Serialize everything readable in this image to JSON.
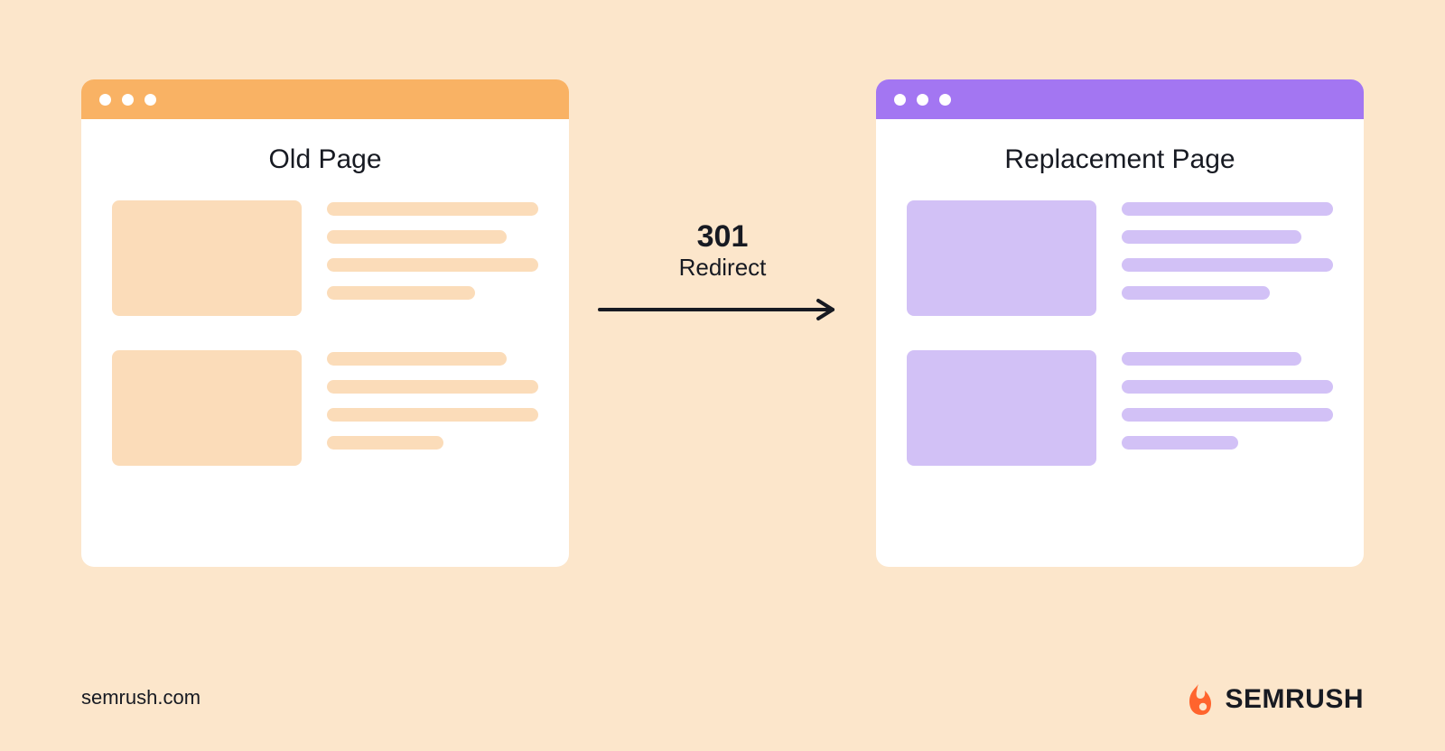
{
  "diagram": {
    "left_page_title": "Old Page",
    "right_page_title": "Replacement Page",
    "redirect_code": "301",
    "redirect_label": "Redirect"
  },
  "colors": {
    "background": "#fce6cb",
    "left_accent": "#f9b264",
    "left_tint": "#fbdcb9",
    "right_accent": "#a376f2",
    "right_tint": "#d2c1f6",
    "brand_orange": "#ff642d",
    "text": "#171a22"
  },
  "footer": {
    "url": "semrush.com",
    "brand_name": "SEMRUSH"
  }
}
